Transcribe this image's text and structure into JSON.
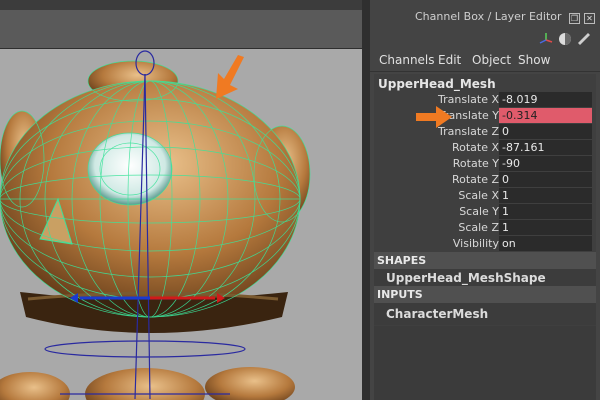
{
  "panel": {
    "title": "Channel Box / Layer Editor",
    "menu": [
      "Channels",
      "Edit",
      "Object",
      "Show"
    ]
  },
  "object": {
    "name": "UpperHead_Mesh",
    "channels": [
      {
        "label": "Translate X",
        "value": "-8.019"
      },
      {
        "label": "Translate Y",
        "value": "-0.314",
        "highlighted": true
      },
      {
        "label": "Translate Z",
        "value": "0"
      },
      {
        "label": "Rotate X",
        "value": "-87.161"
      },
      {
        "label": "Rotate Y",
        "value": "-90"
      },
      {
        "label": "Rotate Z",
        "value": "0"
      },
      {
        "label": "Scale X",
        "value": "1"
      },
      {
        "label": "Scale Y",
        "value": "1"
      },
      {
        "label": "Scale Z",
        "value": "1"
      },
      {
        "label": "Visibility",
        "value": "on"
      }
    ]
  },
  "shapes": {
    "header": "SHAPES",
    "items": [
      "UpperHead_MeshShape"
    ]
  },
  "inputs": {
    "header": "INPUTS",
    "items": [
      "CharacterMesh"
    ]
  },
  "colors": {
    "highlight": "#e05b6b",
    "annotation_arrow": "#f07a22",
    "wireframe": "#3be39a"
  },
  "icons": [
    "restore-icon",
    "close-icon",
    "axis-icon",
    "shading-icon",
    "layers-icon",
    "arrow-annotation"
  ]
}
